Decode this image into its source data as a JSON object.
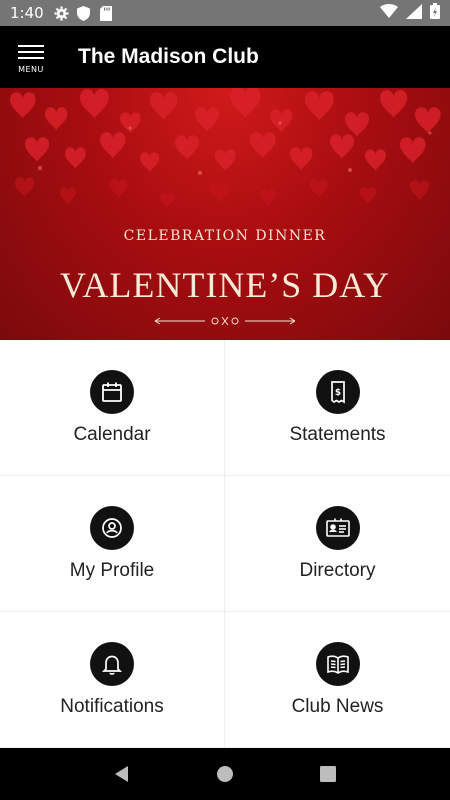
{
  "status_bar": {
    "time": "1:40",
    "icons": [
      "gear-icon",
      "shield-icon",
      "sd-card-icon"
    ],
    "right_icons": [
      "wifi-icon",
      "signal-icon",
      "battery-icon"
    ]
  },
  "app_bar": {
    "menu_label": "MENU",
    "title": "The Madison Club"
  },
  "banner": {
    "tagline": "CELEBRATION DINNER",
    "headline": "VALENTINE’S DAY"
  },
  "tiles": [
    {
      "label": "Calendar",
      "icon": "calendar-icon"
    },
    {
      "label": "Statements",
      "icon": "statement-icon"
    },
    {
      "label": "My Profile",
      "icon": "profile-icon"
    },
    {
      "label": "Directory",
      "icon": "directory-icon"
    },
    {
      "label": "Notifications",
      "icon": "bell-icon"
    },
    {
      "label": "Club News",
      "icon": "news-icon"
    }
  ],
  "nav_bar": [
    "back-icon",
    "home-icon",
    "recents-icon"
  ],
  "colors": {
    "app_bar": "#000000",
    "status_bar": "#757575",
    "banner_red": "#a80d10",
    "icon_circle": "#111111"
  }
}
